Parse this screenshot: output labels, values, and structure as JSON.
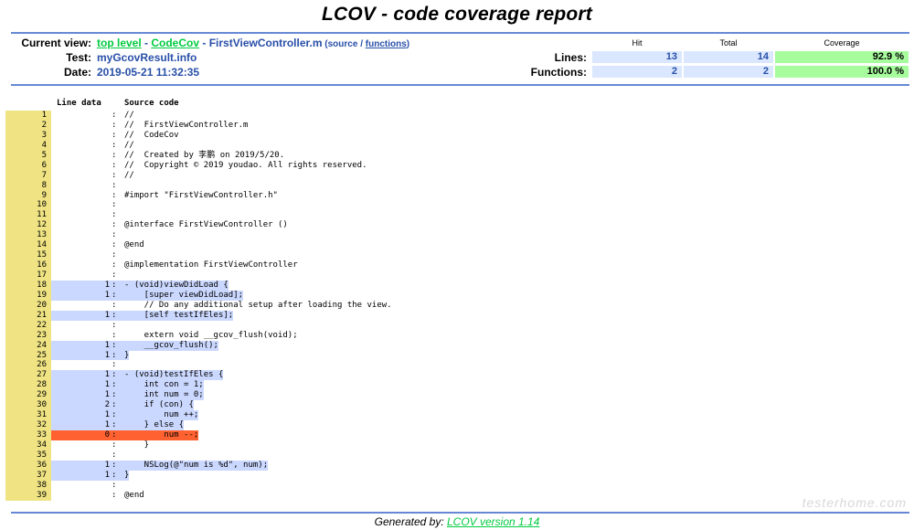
{
  "title": "LCOV - code coverage report",
  "header": {
    "current_view_label": "Current view:",
    "breadcrumb": {
      "top_level": "top level",
      "sep1": " - ",
      "dir": "CodeCov",
      "sep2": " - ",
      "file": "FirstViewController.m",
      "paren_open": " (",
      "source_link": "source",
      "slash": " / ",
      "functions_link": "functions",
      "paren_close": ")"
    },
    "test_label": "Test:",
    "test_value": "myGcovResult.info",
    "date_label": "Date:",
    "date_value": "2019-05-21 11:32:35"
  },
  "stats": {
    "col_hit": "Hit",
    "col_total": "Total",
    "col_coverage": "Coverage",
    "lines_label": "Lines:",
    "lines_hit": "13",
    "lines_total": "14",
    "lines_coverage": "92.9 %",
    "functions_label": "Functions:",
    "functions_hit": "2",
    "functions_total": "2",
    "functions_coverage": "100.0 %"
  },
  "source_header": {
    "line_data": "Line data",
    "source_code": "Source code"
  },
  "colors": {
    "line_number_bg": "#efe383",
    "covered_bg": "#cad7fe",
    "missed_bg": "#ff6230",
    "ruler": "#6688d4",
    "coverage_high": "#a7fc9d"
  },
  "lines": [
    {
      "n": "1",
      "hits": "",
      "code": "//",
      "status": "none"
    },
    {
      "n": "2",
      "hits": "",
      "code": "//  FirstViewController.m",
      "status": "none"
    },
    {
      "n": "3",
      "hits": "",
      "code": "//  CodeCov",
      "status": "none"
    },
    {
      "n": "4",
      "hits": "",
      "code": "//",
      "status": "none"
    },
    {
      "n": "5",
      "hits": "",
      "code": "//  Created by 李鹏 on 2019/5/20.",
      "status": "none"
    },
    {
      "n": "6",
      "hits": "",
      "code": "//  Copyright © 2019 youdao. All rights reserved.",
      "status": "none"
    },
    {
      "n": "7",
      "hits": "",
      "code": "//",
      "status": "none"
    },
    {
      "n": "8",
      "hits": "",
      "code": "",
      "status": "none"
    },
    {
      "n": "9",
      "hits": "",
      "code": "#import \"FirstViewController.h\"",
      "status": "none"
    },
    {
      "n": "10",
      "hits": "",
      "code": "",
      "status": "none"
    },
    {
      "n": "11",
      "hits": "",
      "code": "",
      "status": "none"
    },
    {
      "n": "12",
      "hits": "",
      "code": "@interface FirstViewController ()",
      "status": "none"
    },
    {
      "n": "13",
      "hits": "",
      "code": "",
      "status": "none"
    },
    {
      "n": "14",
      "hits": "",
      "code": "@end",
      "status": "none"
    },
    {
      "n": "15",
      "hits": "",
      "code": "",
      "status": "none"
    },
    {
      "n": "16",
      "hits": "",
      "code": "@implementation FirstViewController",
      "status": "none"
    },
    {
      "n": "17",
      "hits": "",
      "code": "",
      "status": "none"
    },
    {
      "n": "18",
      "hits": "1",
      "code": "- (void)viewDidLoad {",
      "status": "covered"
    },
    {
      "n": "19",
      "hits": "1",
      "code": "    [super viewDidLoad];",
      "status": "covered"
    },
    {
      "n": "20",
      "hits": "",
      "code": "    // Do any additional setup after loading the view.",
      "status": "none"
    },
    {
      "n": "21",
      "hits": "1",
      "code": "    [self testIfEles];",
      "status": "covered"
    },
    {
      "n": "22",
      "hits": "",
      "code": "",
      "status": "none"
    },
    {
      "n": "23",
      "hits": "",
      "code": "    extern void __gcov_flush(void);",
      "status": "none"
    },
    {
      "n": "24",
      "hits": "1",
      "code": "    __gcov_flush();",
      "status": "covered"
    },
    {
      "n": "25",
      "hits": "1",
      "code": "}",
      "status": "covered"
    },
    {
      "n": "26",
      "hits": "",
      "code": "",
      "status": "none"
    },
    {
      "n": "27",
      "hits": "1",
      "code": "- (void)testIfEles {",
      "status": "covered"
    },
    {
      "n": "28",
      "hits": "1",
      "code": "    int con = 1;",
      "status": "covered"
    },
    {
      "n": "29",
      "hits": "1",
      "code": "    int num = 0;",
      "status": "covered"
    },
    {
      "n": "30",
      "hits": "2",
      "code": "    if (con) {",
      "status": "covered"
    },
    {
      "n": "31",
      "hits": "1",
      "code": "        num ++;",
      "status": "covered"
    },
    {
      "n": "32",
      "hits": "1",
      "code": "    } else {",
      "status": "covered"
    },
    {
      "n": "33",
      "hits": "0",
      "code": "        num --;",
      "status": "missed"
    },
    {
      "n": "34",
      "hits": "",
      "code": "    }",
      "status": "none"
    },
    {
      "n": "35",
      "hits": "",
      "code": "",
      "status": "none"
    },
    {
      "n": "36",
      "hits": "1",
      "code": "    NSLog(@\"num is %d\", num);",
      "status": "covered"
    },
    {
      "n": "37",
      "hits": "1",
      "code": "}",
      "status": "covered"
    },
    {
      "n": "38",
      "hits": "",
      "code": "",
      "status": "none"
    },
    {
      "n": "39",
      "hits": "",
      "code": "@end",
      "status": "none"
    }
  ],
  "footer": {
    "generated_by": "Generated by: ",
    "lcov_link": "LCOV version 1.14"
  },
  "watermark": "testerhome.com"
}
